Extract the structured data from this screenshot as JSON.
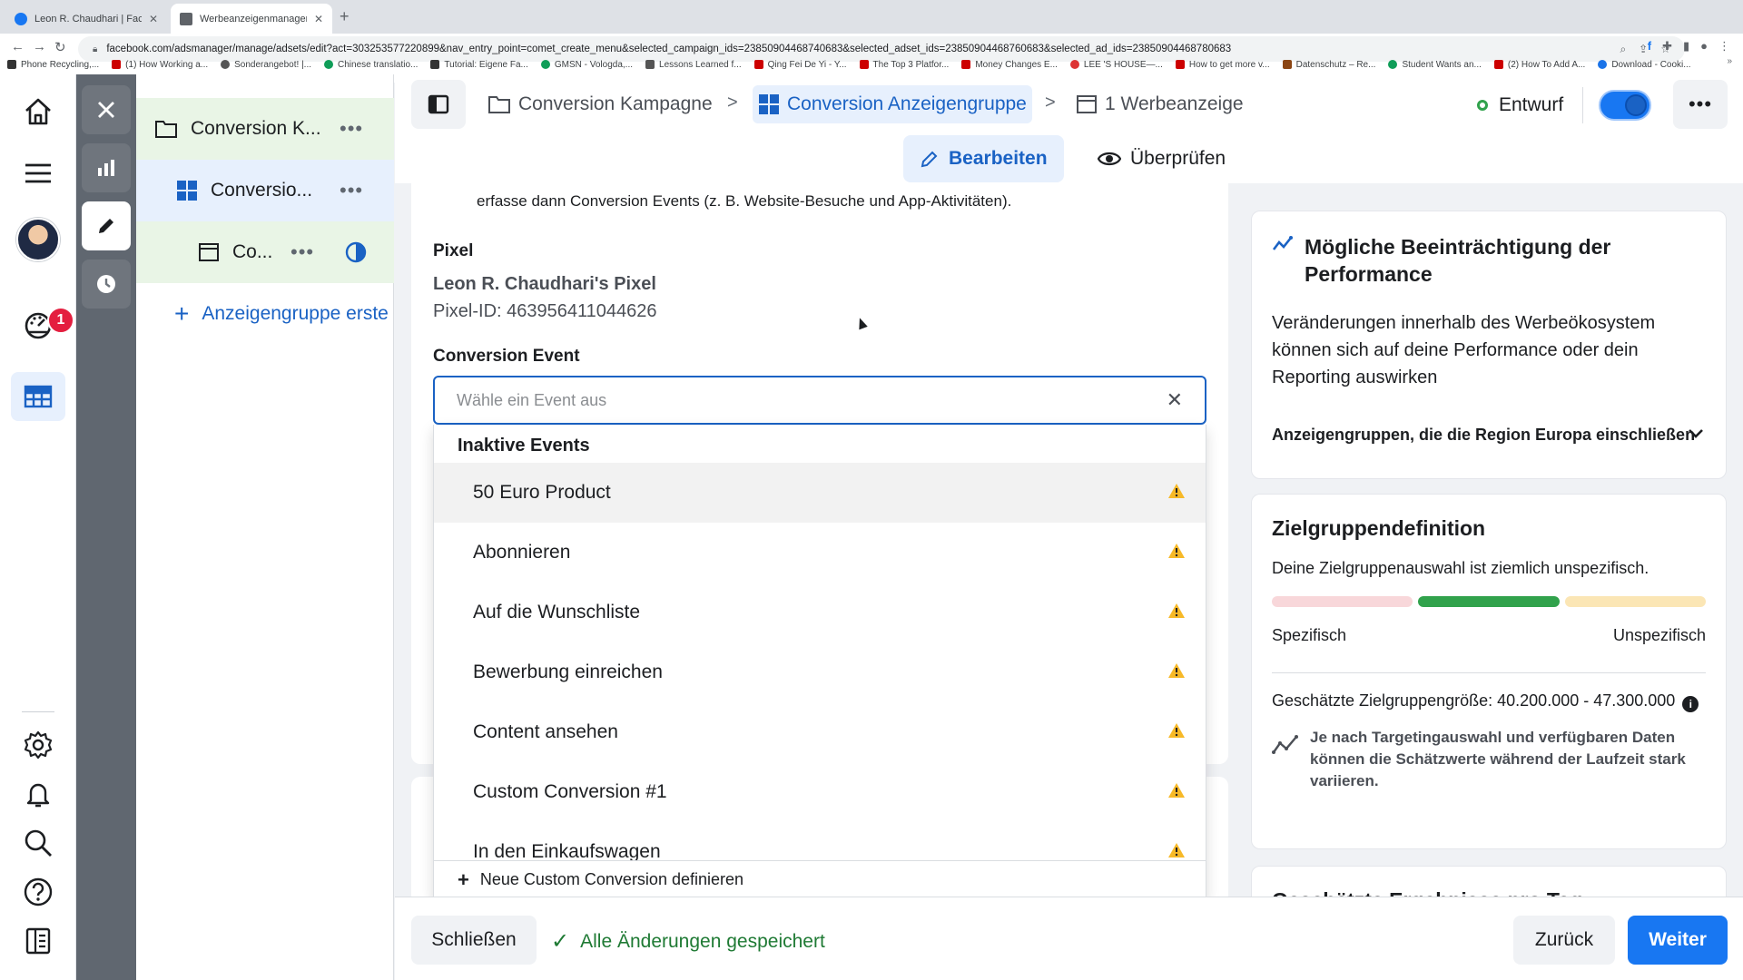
{
  "browser": {
    "tabs": [
      {
        "title": "Leon R. Chaudhari | Facebook"
      },
      {
        "title": "Werbeanzeigenmanager - Werk"
      }
    ],
    "new_tab": "+",
    "url": "facebook.com/adsmanager/manage/adsets/edit?act=303253577220899&nav_entry_point=comet_create_menu&selected_campaign_ids=23850904468740683&selected_adset_ids=23850904468760683&selected_ad_ids=23850904468780683",
    "bookmarks": [
      "Phone Recycling,...",
      "(1) How Working a...",
      "Sonderangebot! |...",
      "Chinese translatio...",
      "Tutorial: Eigene Fa...",
      "GMSN - Vologda,...",
      "Lessons Learned f...",
      "Qing Fei De Yi - Y...",
      "The Top 3 Platfor...",
      "Money Changes E...",
      "LEE 'S HOUSE—...",
      "How to get more v...",
      "Datenschutz – Re...",
      "Student Wants an...",
      "(2) How To Add A...",
      "Download - Cooki..."
    ],
    "bookmarks_more": "»"
  },
  "rail": {
    "notification_count": "1"
  },
  "tree": {
    "campaign_label": "Conversion K...",
    "adset_label": "Conversio...",
    "ad_label": "Co...",
    "more": "•••",
    "add_label": "Anzeigengruppe erste",
    "add_plus": "+"
  },
  "topbar": {
    "breadcrumbs": [
      "Conversion Kampagne",
      "Conversion Anzeigengruppe",
      "1 Werbeanzeige"
    ],
    "separator": ">",
    "status": "Entwurf",
    "more": "•••",
    "mode_edit": "Bearbeiten",
    "mode_review": "Überprüfen"
  },
  "form": {
    "intro": "erfasse dann Conversion Events (z. B. Website-Besuche und App-Aktivitäten).",
    "pixel_label": "Pixel",
    "pixel_name": "Leon R. Chaudhari's Pixel",
    "pixel_id": "Pixel-ID: 463956411044626",
    "event_label": "Conversion Event",
    "event_placeholder": "Wähle ein Event aus",
    "event_value": "",
    "clear": "✕"
  },
  "dropdown": {
    "group": "Inaktive Events",
    "items": [
      "50 Euro Product",
      "Abonnieren",
      "Auf die Wunschliste",
      "Bewerbung einreichen",
      "Content ansehen",
      "Custom Conversion #1",
      "In den Einkaufswagen"
    ],
    "footer": "Neue Custom Conversion definieren",
    "footer_plus": "+"
  },
  "sidebar": {
    "perf_title": "Mögliche Beeinträchtigung der Performance",
    "perf_text": "Veränderungen innerhalb des Werbeökosystem können sich auf deine Performance oder dein Reporting auswirken",
    "perf_link": "Anzeigengruppen, die die Region Europa einschließen",
    "aud_title": "Zielgruppendefinition",
    "aud_text": "Deine Zielgruppenauswahl ist ziemlich unspezifisch.",
    "aud_left": "Spezifisch",
    "aud_right": "Unspezifisch",
    "aud_meter_level": 0.5,
    "aud_size": "Geschätzte Zielgruppengröße: 40.200.000 - 47.300.000",
    "aud_info": "i",
    "aud_note": "Je nach Targetingauswahl und verfügbaren Daten können die Schätzwerte während der Laufzeit stark variieren.",
    "est_title": "Geschätzte Ergebnisse pro Tag"
  },
  "footer": {
    "close": "Schließen",
    "check": "✓",
    "saved": "Alle Änderungen gespeichert",
    "back": "Zurück",
    "next": "Weiter"
  },
  "colors": {
    "accent": "#1877f2",
    "accent_dark": "#1a62c4",
    "accent_bg": "#e7f0fd",
    "success": "#31a24c",
    "warning": "#f7b928",
    "danger": "#e41e3f",
    "meter_low": "#f8d7da",
    "meter_mid": "#31a24c",
    "meter_high": "#fbe6b5"
  }
}
